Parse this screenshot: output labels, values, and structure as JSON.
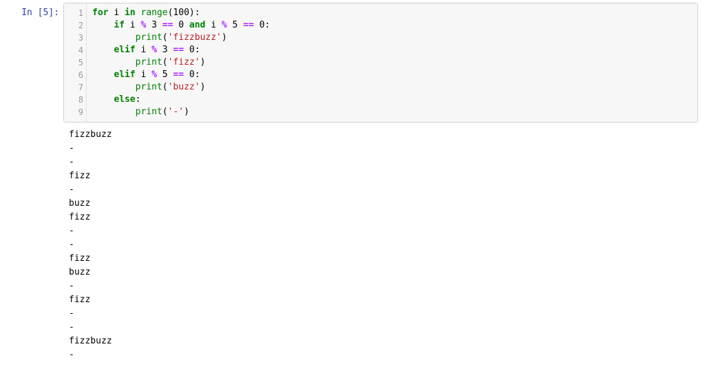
{
  "cell": {
    "prompt": "In [5]:",
    "exec_count": 5,
    "gutter_lines": [
      "1",
      "2",
      "3",
      "4",
      "5",
      "6",
      "7",
      "8",
      "9"
    ],
    "code_tokens": [
      [
        {
          "t": "for",
          "c": "kw"
        },
        {
          "t": " ",
          "c": "sp"
        },
        {
          "t": "i",
          "c": "name"
        },
        {
          "t": " ",
          "c": "sp"
        },
        {
          "t": "in",
          "c": "kw"
        },
        {
          "t": " ",
          "c": "sp"
        },
        {
          "t": "range",
          "c": "func"
        },
        {
          "t": "(",
          "c": "punc"
        },
        {
          "t": "100",
          "c": "num"
        },
        {
          "t": ")",
          "c": "punc"
        },
        {
          "t": ":",
          "c": "punc"
        }
      ],
      [
        {
          "t": "    ",
          "c": "sp"
        },
        {
          "t": "if",
          "c": "kw"
        },
        {
          "t": " ",
          "c": "sp"
        },
        {
          "t": "i",
          "c": "name"
        },
        {
          "t": " ",
          "c": "sp"
        },
        {
          "t": "%",
          "c": "op"
        },
        {
          "t": " ",
          "c": "sp"
        },
        {
          "t": "3",
          "c": "num"
        },
        {
          "t": " ",
          "c": "sp"
        },
        {
          "t": "==",
          "c": "op"
        },
        {
          "t": " ",
          "c": "sp"
        },
        {
          "t": "0",
          "c": "num"
        },
        {
          "t": " ",
          "c": "sp"
        },
        {
          "t": "and",
          "c": "kw"
        },
        {
          "t": " ",
          "c": "sp"
        },
        {
          "t": "i",
          "c": "name"
        },
        {
          "t": " ",
          "c": "sp"
        },
        {
          "t": "%",
          "c": "op"
        },
        {
          "t": " ",
          "c": "sp"
        },
        {
          "t": "5",
          "c": "num"
        },
        {
          "t": " ",
          "c": "sp"
        },
        {
          "t": "==",
          "c": "op"
        },
        {
          "t": " ",
          "c": "sp"
        },
        {
          "t": "0",
          "c": "num"
        },
        {
          "t": ":",
          "c": "punc"
        }
      ],
      [
        {
          "t": "        ",
          "c": "sp"
        },
        {
          "t": "print",
          "c": "func"
        },
        {
          "t": "(",
          "c": "punc"
        },
        {
          "t": "'fizzbuzz'",
          "c": "str"
        },
        {
          "t": ")",
          "c": "punc"
        }
      ],
      [
        {
          "t": "    ",
          "c": "sp"
        },
        {
          "t": "elif",
          "c": "kw"
        },
        {
          "t": " ",
          "c": "sp"
        },
        {
          "t": "i",
          "c": "name"
        },
        {
          "t": " ",
          "c": "sp"
        },
        {
          "t": "%",
          "c": "op"
        },
        {
          "t": " ",
          "c": "sp"
        },
        {
          "t": "3",
          "c": "num"
        },
        {
          "t": " ",
          "c": "sp"
        },
        {
          "t": "==",
          "c": "op"
        },
        {
          "t": " ",
          "c": "sp"
        },
        {
          "t": "0",
          "c": "num"
        },
        {
          "t": ":",
          "c": "punc"
        }
      ],
      [
        {
          "t": "        ",
          "c": "sp"
        },
        {
          "t": "print",
          "c": "func"
        },
        {
          "t": "(",
          "c": "punc"
        },
        {
          "t": "'fizz'",
          "c": "str"
        },
        {
          "t": ")",
          "c": "punc"
        }
      ],
      [
        {
          "t": "    ",
          "c": "sp"
        },
        {
          "t": "elif",
          "c": "kw"
        },
        {
          "t": " ",
          "c": "sp"
        },
        {
          "t": "i",
          "c": "name"
        },
        {
          "t": " ",
          "c": "sp"
        },
        {
          "t": "%",
          "c": "op"
        },
        {
          "t": " ",
          "c": "sp"
        },
        {
          "t": "5",
          "c": "num"
        },
        {
          "t": " ",
          "c": "sp"
        },
        {
          "t": "==",
          "c": "op"
        },
        {
          "t": " ",
          "c": "sp"
        },
        {
          "t": "0",
          "c": "num"
        },
        {
          "t": ":",
          "c": "punc"
        }
      ],
      [
        {
          "t": "        ",
          "c": "sp"
        },
        {
          "t": "print",
          "c": "func"
        },
        {
          "t": "(",
          "c": "punc"
        },
        {
          "t": "'buzz'",
          "c": "str"
        },
        {
          "t": ")",
          "c": "punc"
        }
      ],
      [
        {
          "t": "    ",
          "c": "sp"
        },
        {
          "t": "else",
          "c": "kw"
        },
        {
          "t": ":",
          "c": "punc"
        }
      ],
      [
        {
          "t": "        ",
          "c": "sp"
        },
        {
          "t": "print",
          "c": "func"
        },
        {
          "t": "(",
          "c": "punc"
        },
        {
          "t": "'-'",
          "c": "str"
        },
        {
          "t": ")",
          "c": "punc"
        }
      ]
    ],
    "output_lines": [
      "fizzbuzz",
      "-",
      "-",
      "fizz",
      "-",
      "buzz",
      "fizz",
      "-",
      "-",
      "fizz",
      "buzz",
      "-",
      "fizz",
      "-",
      "-",
      "fizzbuzz",
      "-"
    ]
  }
}
